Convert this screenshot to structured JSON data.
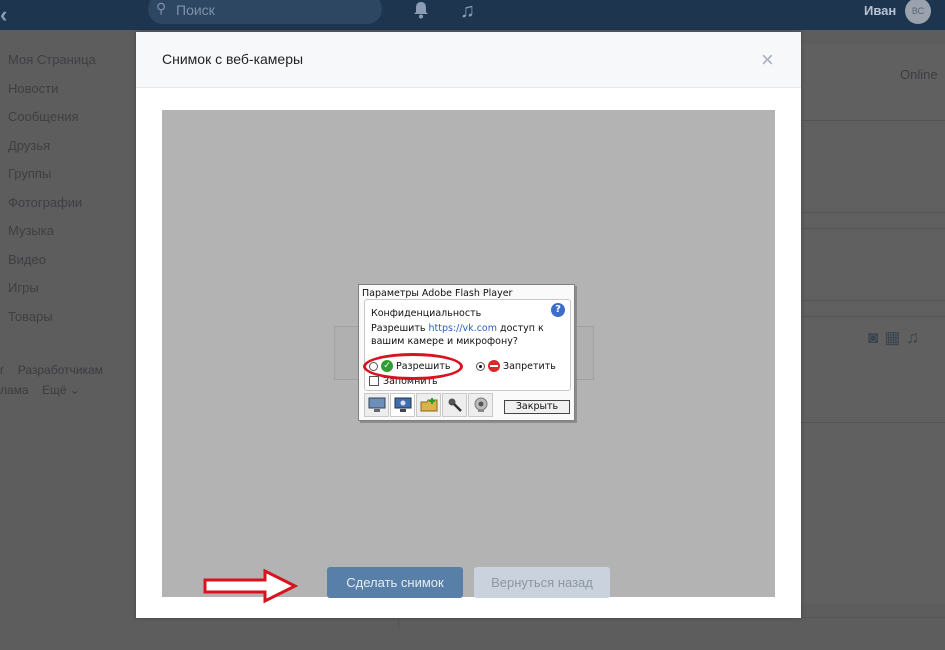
{
  "topbar": {
    "search_placeholder": "Поиск",
    "user_name": "Иван",
    "avatar_label": "ВС"
  },
  "sidebar": {
    "items": [
      {
        "label": "Моя Страница"
      },
      {
        "label": "Новости"
      },
      {
        "label": "Сообщения"
      },
      {
        "label": "Друзья"
      },
      {
        "label": "Группы"
      },
      {
        "label": "Фотографии"
      },
      {
        "label": "Музыка"
      },
      {
        "label": "Видео"
      },
      {
        "label": "Игры"
      },
      {
        "label": "Товары"
      }
    ],
    "footer_line1": [
      "г",
      "Разработчикам"
    ],
    "footer_line2": [
      "лама",
      "Ещё ⌄"
    ]
  },
  "right_column": {
    "status": "Online"
  },
  "modal": {
    "title": "Снимок с веб-камеры",
    "close_symbol": "×",
    "take_photo_label": "Сделать снимок",
    "go_back_label": "Вернуться назад"
  },
  "flash_dialog": {
    "title": "Параметры Adobe Flash Player",
    "heading": "Конфиденциальность",
    "question_prefix": "Разрешить ",
    "question_link": "https://vk.com",
    "question_suffix": " доступ к вашим камере и микрофону?",
    "allow_label": "Разрешить",
    "deny_label": "Запретить",
    "remember_label": "Запомнить",
    "close_label": "Закрыть",
    "selected_option": "deny"
  },
  "colors": {
    "topbar": "#1e3550",
    "primary_button": "#587fa7",
    "secondary_button": "#cad3dd",
    "highlight": "#d8121e"
  }
}
